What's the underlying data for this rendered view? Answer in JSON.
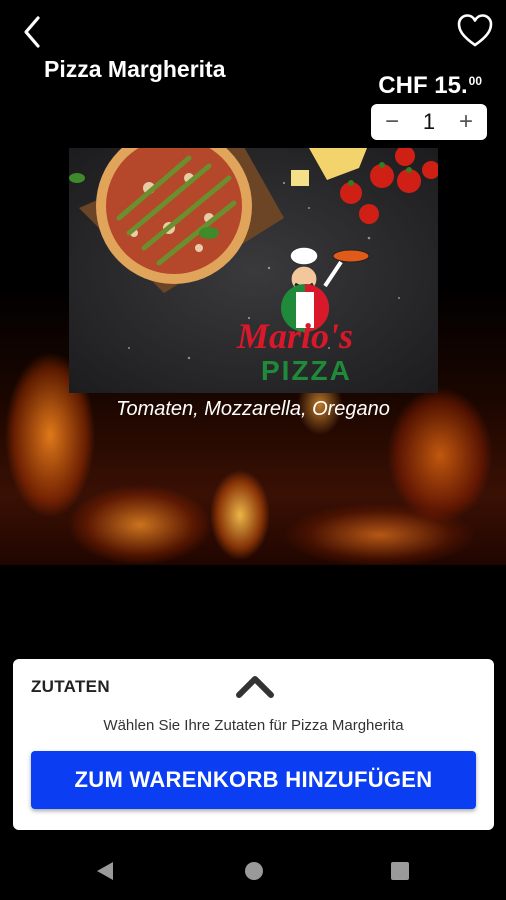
{
  "product": {
    "title": "Pizza Margherita",
    "price_main": "CHF 15.",
    "price_cents": "00",
    "description": "Tomaten, Mozzarella, Oregano"
  },
  "quantity": {
    "minus": "−",
    "value": "1",
    "plus": "+"
  },
  "image": {
    "brand_name": "Mario's",
    "brand_sub": "PIZZA"
  },
  "panel": {
    "section_label": "ZUTATEN",
    "hint": "Wählen Sie Ihre Zutaten für Pizza Margherita",
    "add_to_cart": "ZUM WARENKORB HINZUFÜGEN"
  },
  "icons": {
    "back": "back-arrow-icon",
    "favorite": "heart-icon",
    "expand": "chevron-up-icon",
    "nav_back": "triangle-back-icon",
    "nav_home": "circle-home-icon",
    "nav_recent": "square-recents-icon"
  },
  "colors": {
    "accent": "#0b3df2",
    "background": "#000000",
    "brand_red": "#d9182a",
    "brand_green": "#1e8a3a"
  }
}
